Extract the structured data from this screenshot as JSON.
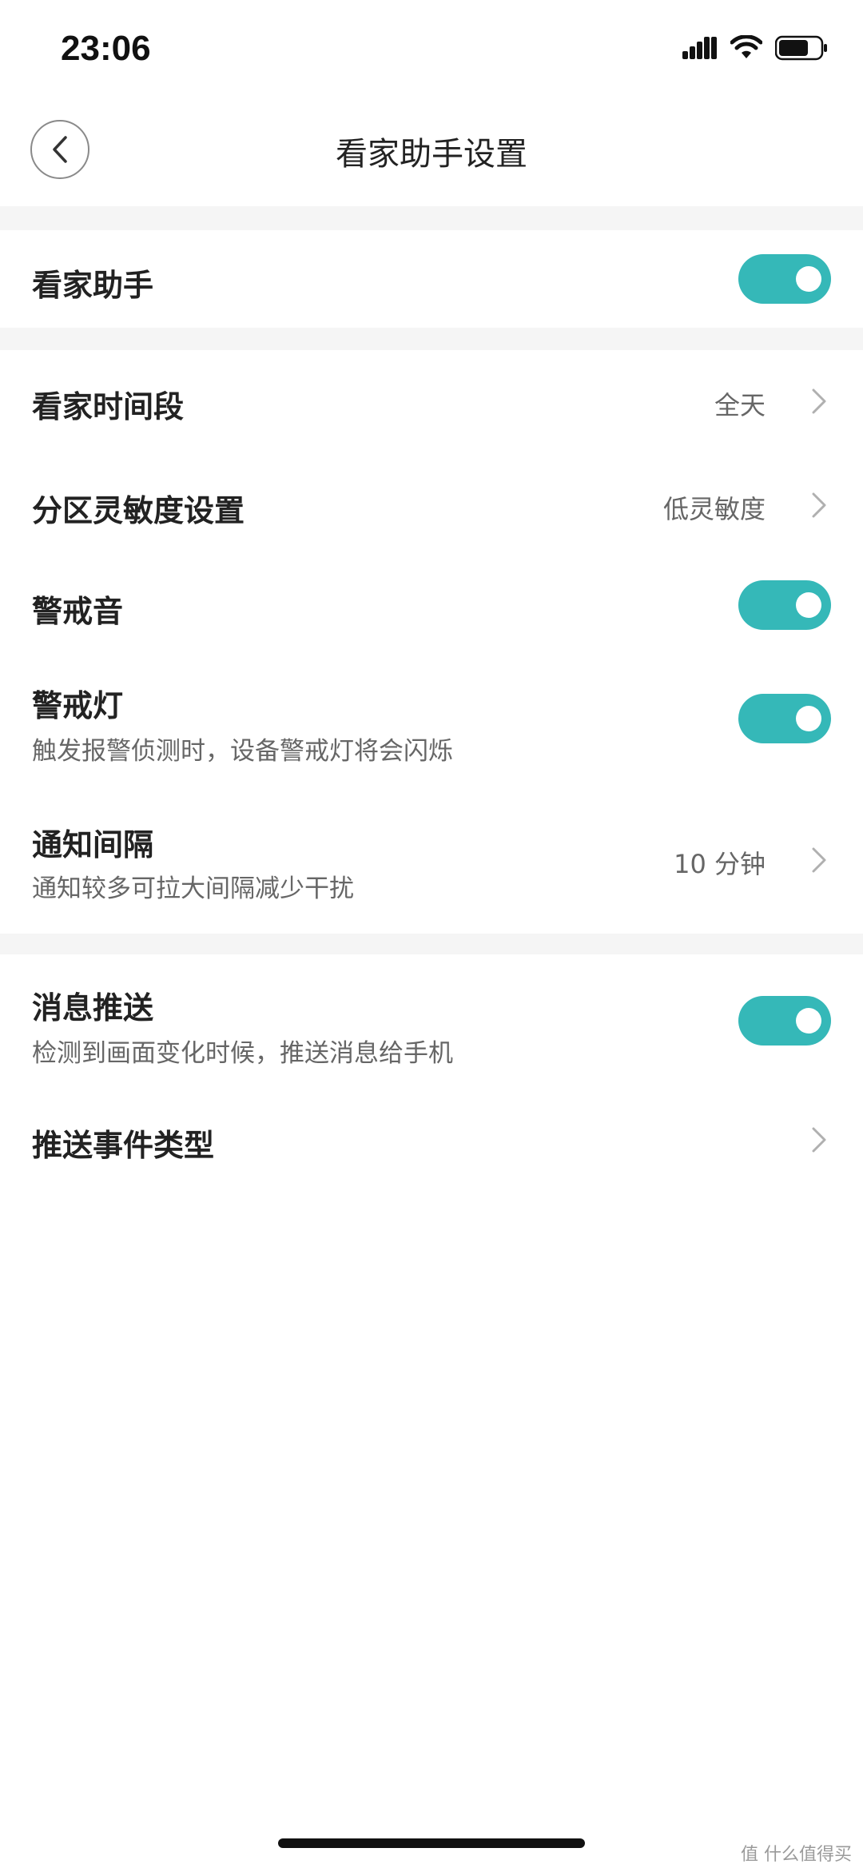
{
  "status_bar": {
    "time": "23:06"
  },
  "nav": {
    "title": "看家助手设置",
    "back_icon": "chevron-left-icon"
  },
  "sections": {
    "assistant": {
      "title": "看家助手",
      "enabled": true
    },
    "period": {
      "title": "看家时间段",
      "value": "全天"
    },
    "sensitivity": {
      "title": "分区灵敏度设置",
      "value": "低灵敏度"
    },
    "alarm_sound": {
      "title": "警戒音",
      "enabled": true
    },
    "alarm_light": {
      "title": "警戒灯",
      "subtitle": "触发报警侦测时，设备警戒灯将会闪烁",
      "enabled": true
    },
    "notify_interval": {
      "title": "通知间隔",
      "subtitle": "通知较多可拉大间隔减少干扰",
      "value": "10 分钟"
    },
    "push": {
      "title": "消息推送",
      "subtitle": "检测到画面变化时候，推送消息给手机",
      "enabled": true
    },
    "push_types": {
      "title": "推送事件类型"
    }
  },
  "watermark": "值 什么值得买",
  "colors": {
    "toggle_on": "#35b8b8",
    "section_gap": "#f5f5f5"
  }
}
